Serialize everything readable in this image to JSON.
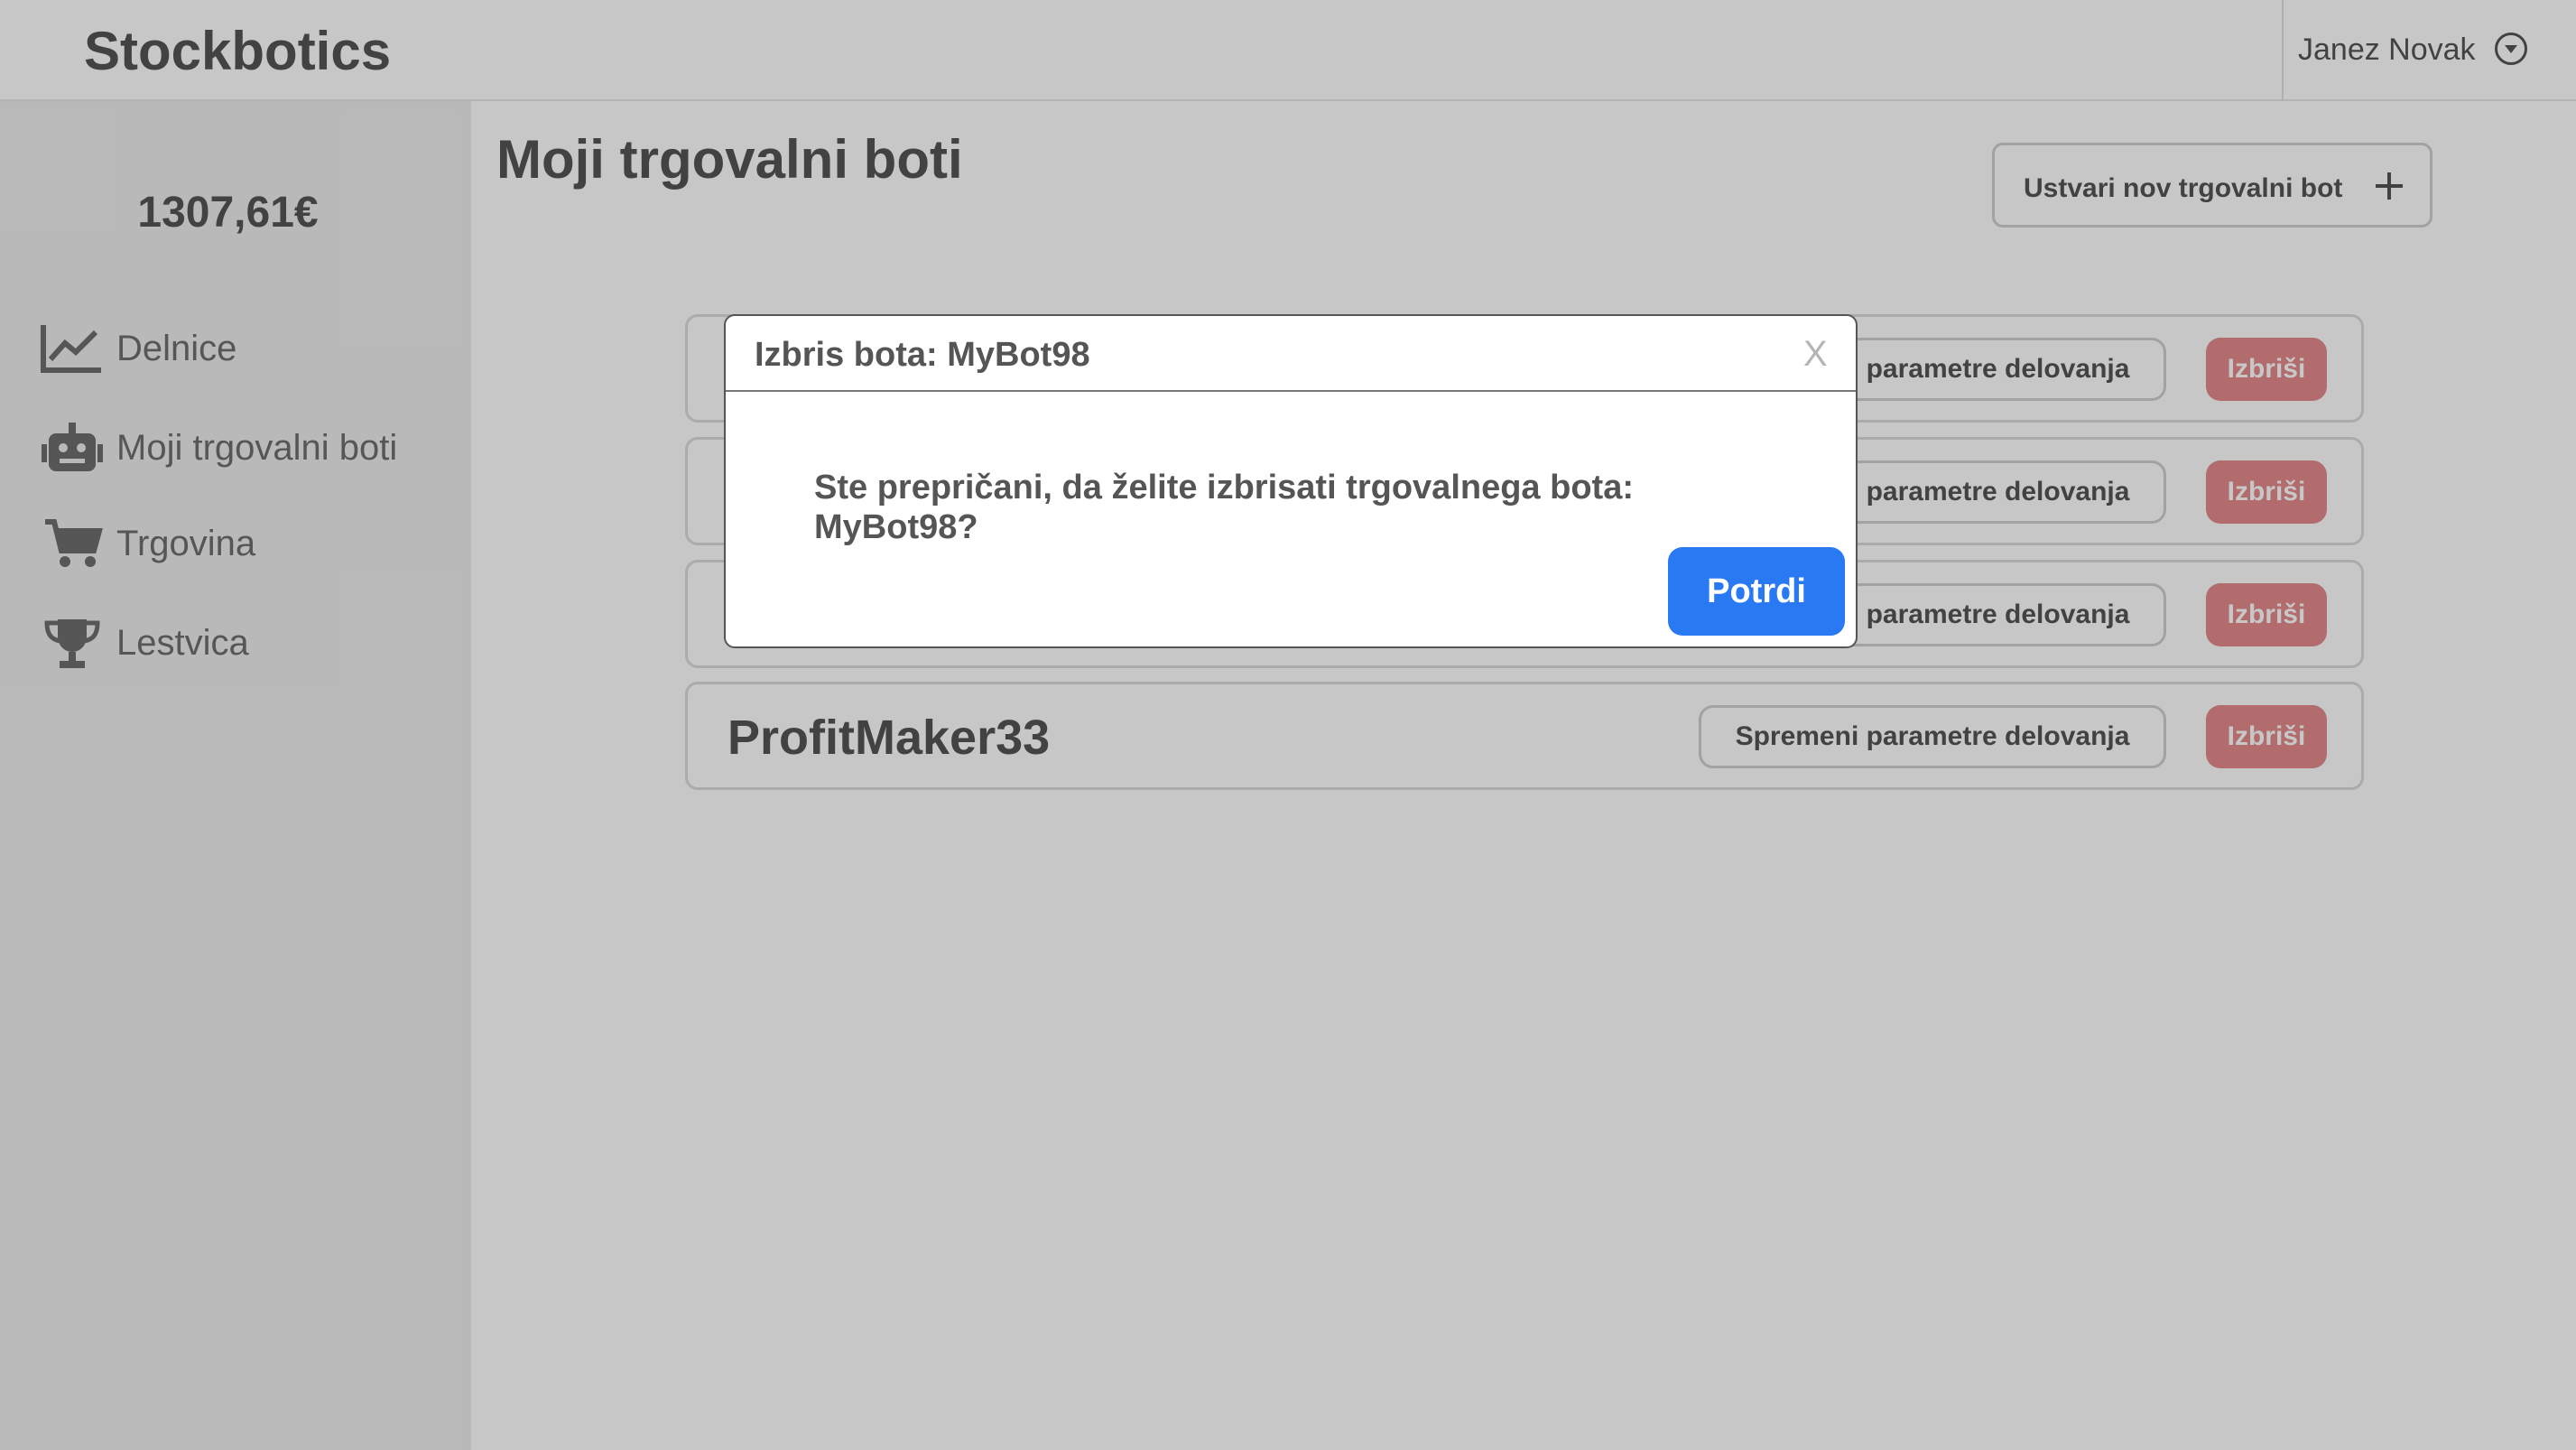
{
  "app": {
    "brand": "Stockbotics",
    "user_name": "Janez Novak"
  },
  "sidebar": {
    "balance": "1307,61€",
    "items": [
      {
        "label": "Delnice",
        "icon": "chart-line-icon"
      },
      {
        "label": "Moji trgovalni boti",
        "icon": "robot-icon"
      },
      {
        "label": "Trgovina",
        "icon": "shopping-cart-icon"
      },
      {
        "label": "Lestvica",
        "icon": "trophy-icon"
      }
    ]
  },
  "main": {
    "title": "Moji trgovalni boti",
    "create_button_label": "Ustvari nov trgovalni bot",
    "bots": [
      {
        "name": "",
        "params_label": "Spremeni parametre delovanja",
        "delete_label": "Izbriši"
      },
      {
        "name": "",
        "params_label": "Spremeni parametre delovanja",
        "delete_label": "Izbriši"
      },
      {
        "name": "",
        "params_label": "Spremeni parametre delovanja",
        "delete_label": "Izbriši"
      },
      {
        "name": "ProfitMaker33",
        "params_label": "Spremeni parametre delovanja",
        "delete_label": "Izbriši"
      }
    ]
  },
  "modal": {
    "title": "Izbris bota: MyBot98",
    "close_label": "X",
    "message": "Ste prepričani, da želite izbrisati trgovalnega bota: MyBot98?",
    "confirm_label": "Potrdi"
  },
  "colors": {
    "confirm": "#2979f2",
    "delete": "#e48b8d",
    "sidebar_bg": "#eeeeee"
  }
}
